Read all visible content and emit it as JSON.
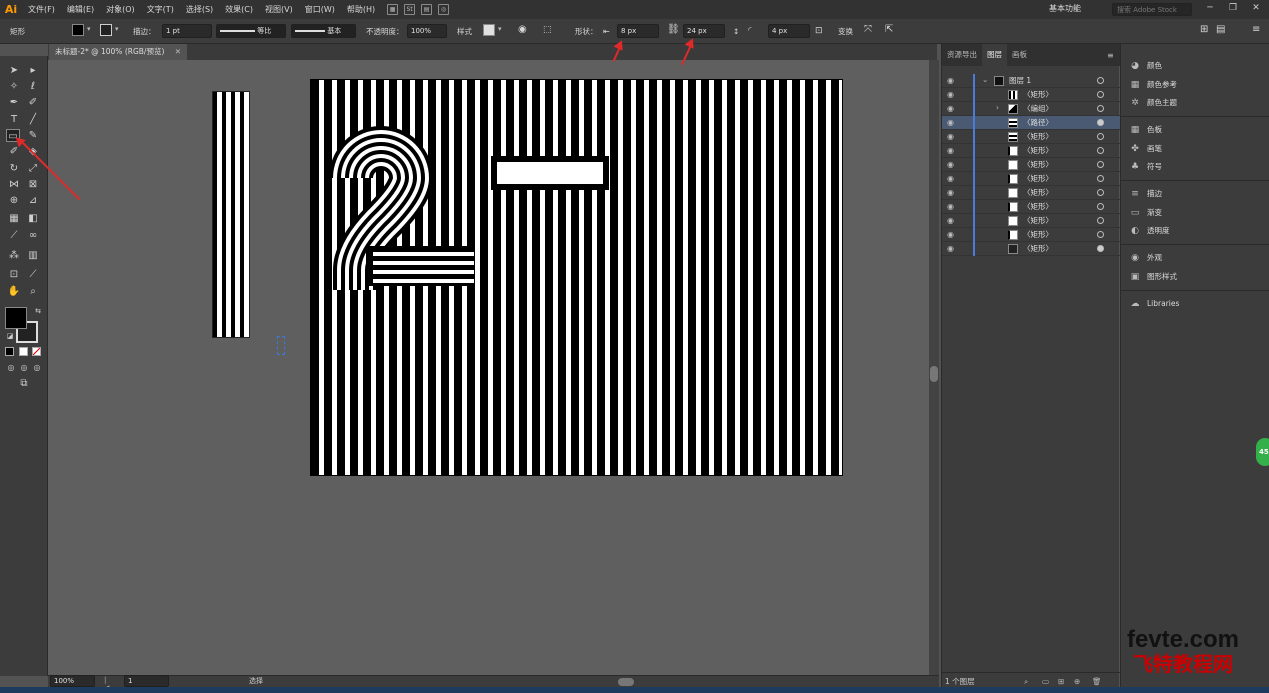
{
  "app": {
    "logo": "Ai"
  },
  "menubar": {
    "items": [
      "文件(F)",
      "编辑(E)",
      "对象(O)",
      "文字(T)",
      "选择(S)",
      "效果(C)",
      "视图(V)",
      "窗口(W)",
      "帮助(H)"
    ],
    "workspace": "基本功能",
    "search_placeholder": "搜索 Adobe Stock"
  },
  "control": {
    "tool_name": "矩形",
    "stroke_label": "描边：",
    "stroke_value": "1 pt",
    "profile_label": "等比",
    "brush_label": "基本",
    "opacity_label": "不透明度：",
    "opacity_value": "100%",
    "style_label": "样式",
    "shape_label": "形状：",
    "width_value": "8 px",
    "height_value": "24 px",
    "corner_value": "4 px",
    "transform_label": "变换"
  },
  "document": {
    "tab_title": "未标题-2* @ 100% (RGB/预览)"
  },
  "status": {
    "zoom": "100%",
    "artboard_num": "1",
    "tool_status": "选择"
  },
  "layers_panel": {
    "tabs": [
      "资源导出",
      "图层",
      "画板"
    ],
    "active_tab": "图层",
    "rows": [
      {
        "name": "图层 1",
        "selected": false
      },
      {
        "name": "〈矩形〉",
        "selected": false
      },
      {
        "name": "〈编组〉",
        "selected": false
      },
      {
        "name": "〈路径〉",
        "selected": true
      },
      {
        "name": "〈矩形〉",
        "selected": false
      },
      {
        "name": "〈矩形〉",
        "selected": false
      },
      {
        "name": "〈矩形〉",
        "selected": false
      },
      {
        "name": "〈矩形〉",
        "selected": false
      },
      {
        "name": "〈矩形〉",
        "selected": false
      },
      {
        "name": "〈矩形〉",
        "selected": false
      },
      {
        "name": "〈矩形〉",
        "selected": false
      },
      {
        "name": "〈矩形〉",
        "selected": false
      },
      {
        "name": "〈矩形〉",
        "selected": false
      }
    ],
    "footer": "1 个图层"
  },
  "right_panel": {
    "items": [
      "颜色",
      "颜色参考",
      "颜色主题",
      "色板",
      "画笔",
      "符号",
      "描边",
      "渐变",
      "透明度",
      "外观",
      "图形样式",
      "Libraries"
    ]
  },
  "watermark": {
    "line1": "fevte.com",
    "line2": "飞特教程网"
  },
  "badge": {
    "text": "45"
  },
  "colors": {
    "accent_arrow": "#e02a2a",
    "selection": "#4a7bd8",
    "ai_logo": "#ff9a00"
  }
}
